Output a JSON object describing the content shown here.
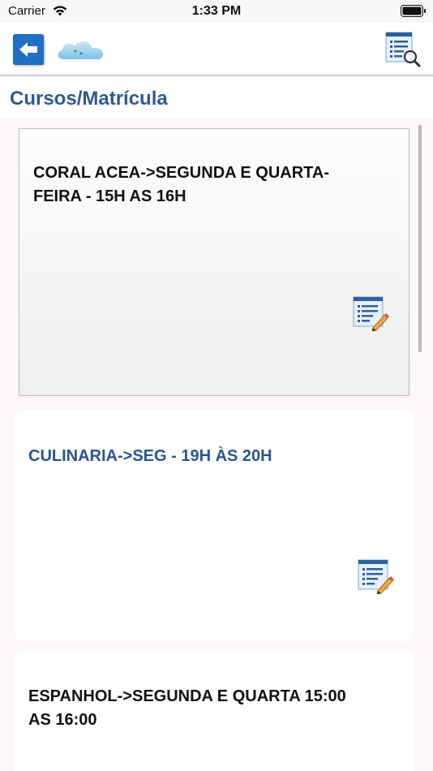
{
  "status_bar": {
    "carrier": "Carrier",
    "time": "1:33 PM"
  },
  "nav": {
    "back_icon": "arrow-left-icon",
    "logo_icon": "cloud-icon",
    "action_icon": "list-search-icon"
  },
  "page": {
    "title": "Cursos/Matrícula"
  },
  "courses": [
    {
      "title": "CORAL ACEA->SEGUNDA E QUARTA-FEIRA - 15H AS 16H",
      "selected": true
    },
    {
      "title": "CULINARIA->SEG - 19H ÀS 20H",
      "selected": false
    },
    {
      "title": "ESPANHOL->SEGUNDA E QUARTA 15:00 AS 16:00",
      "selected": false
    }
  ],
  "colors": {
    "accent": "#2e5a93",
    "back_button": "#1f6fc4",
    "content_bg": "#fdf7f7"
  }
}
